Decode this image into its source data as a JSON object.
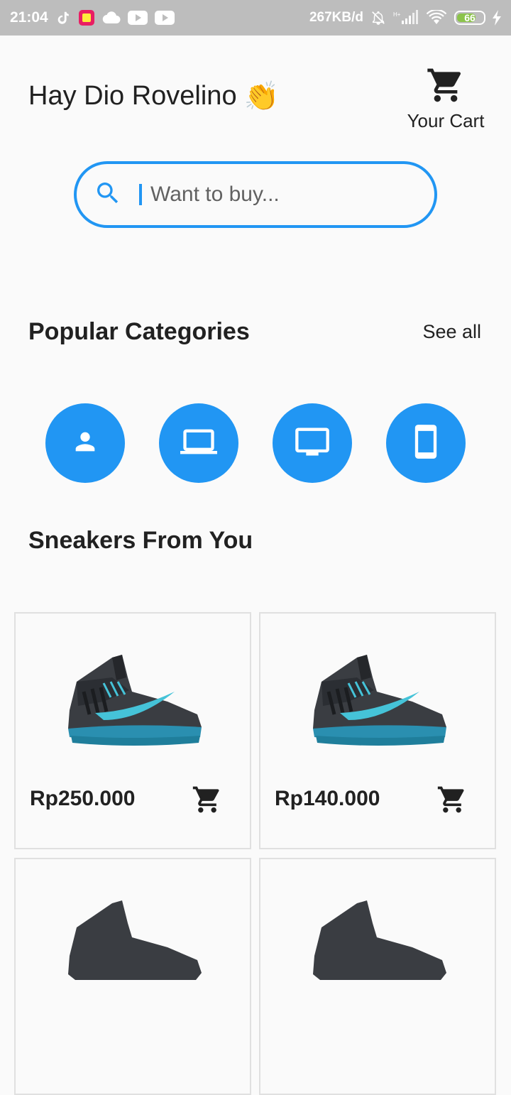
{
  "status_bar": {
    "time": "21:04",
    "network_speed": "267KB/d",
    "battery": "66",
    "icons_left": [
      "tiktok-icon",
      "app-icon",
      "cloud-icon",
      "youtube-icon",
      "youtube-icon"
    ],
    "icons_right": [
      "bell-muted-icon",
      "signal-icon",
      "wifi-icon",
      "battery-icon",
      "charging-icon"
    ]
  },
  "header": {
    "greeting": "Hay Dio Rovelino",
    "emoji": "👏",
    "cart_label": "Your Cart"
  },
  "search": {
    "placeholder": "Want to buy...",
    "value": ""
  },
  "categories_section": {
    "title": "Popular Categories",
    "see_all": "See all",
    "items": [
      {
        "icon": "person-icon"
      },
      {
        "icon": "laptop-icon"
      },
      {
        "icon": "monitor-icon"
      },
      {
        "icon": "smartphone-icon"
      }
    ]
  },
  "sneakers_section": {
    "title": "Sneakers From You",
    "products": [
      {
        "price": "Rp250.000",
        "image": "sneaker-image"
      },
      {
        "price": "Rp140.000",
        "image": "sneaker-image"
      },
      {
        "price": "",
        "image": "sneaker-image"
      },
      {
        "price": "",
        "image": "sneaker-image"
      }
    ]
  },
  "colors": {
    "accent": "#2196f3",
    "status_bar": "#bdbdbd",
    "background": "#fafafa"
  }
}
